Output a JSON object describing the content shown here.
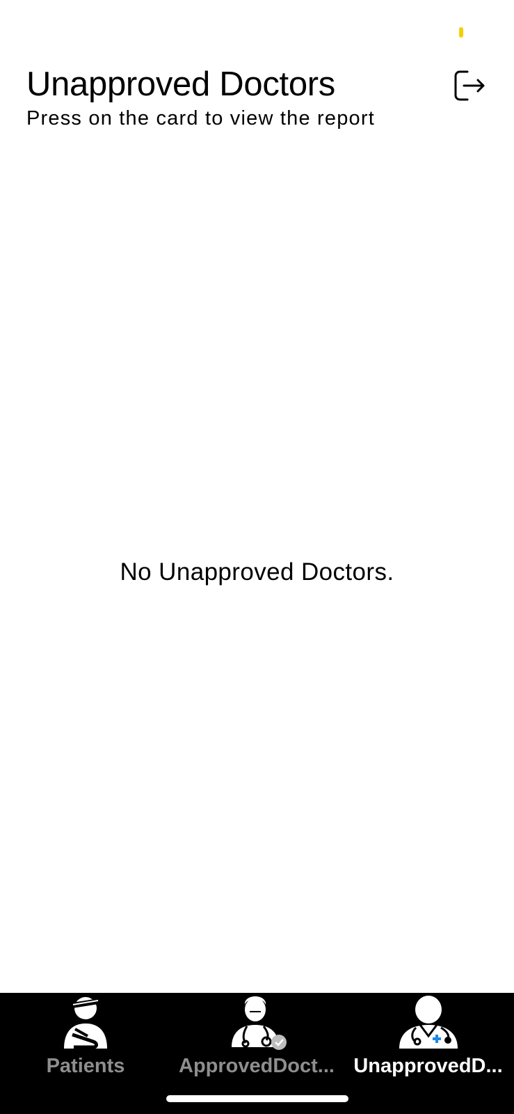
{
  "header": {
    "title": "Unapproved Doctors",
    "subtitle": "Press on the card to view the report",
    "logout_icon": "logout-icon"
  },
  "main": {
    "empty_message": "No Unapproved Doctors."
  },
  "tab_bar": {
    "tabs": [
      {
        "label": "Patients",
        "icon": "patient-icon",
        "active": false
      },
      {
        "label": "ApprovedDoct...",
        "icon": "approved-doctor-icon",
        "active": false
      },
      {
        "label": "UnapprovedD...",
        "icon": "unapproved-doctor-icon",
        "active": true
      }
    ]
  },
  "colors": {
    "status_indicator": "#f5d000",
    "tab_bar_background": "#000000",
    "tab_active": "#ffffff",
    "tab_inactive": "#8e8e8e"
  }
}
